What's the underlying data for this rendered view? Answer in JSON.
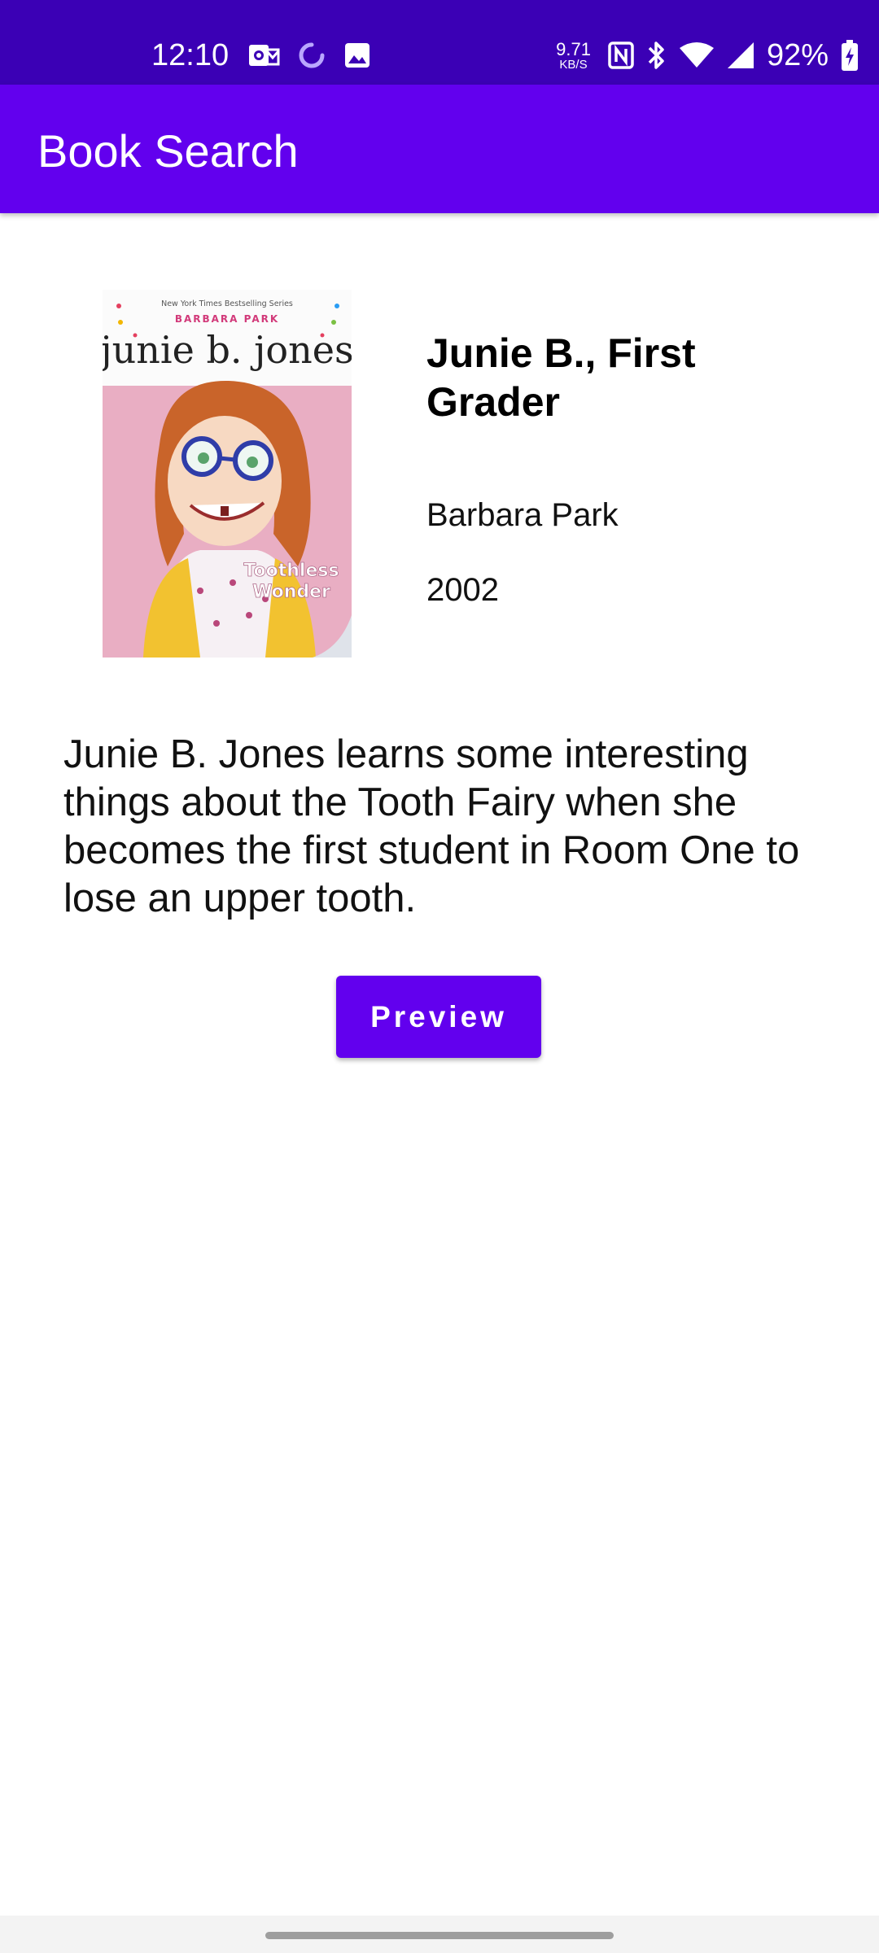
{
  "status_bar": {
    "time": "12:10",
    "net_speed_value": "9.71",
    "net_speed_unit": "KB/S",
    "battery_percent": "92%"
  },
  "app_bar": {
    "title": "Book Search"
  },
  "book": {
    "cover": {
      "series_banner": "New York Times Bestselling Series",
      "author_banner": "BARBARA PARK",
      "series_logo": "junie b. jones",
      "subtitle_line1": "Toothless",
      "subtitle_line2": "Wonder"
    },
    "title": "Junie B., First Grader",
    "author": "Barbara Park",
    "year": "2002",
    "description": "Junie B. Jones learns some interesting things about the Tooth Fairy when she becomes the first student in Room One to lose an upper tooth."
  },
  "actions": {
    "preview_label": "Preview"
  },
  "colors": {
    "status_bar": "#3b00b5",
    "primary": "#6200ee",
    "on_primary": "#ffffff",
    "cover_pink": "#e9aec3"
  }
}
